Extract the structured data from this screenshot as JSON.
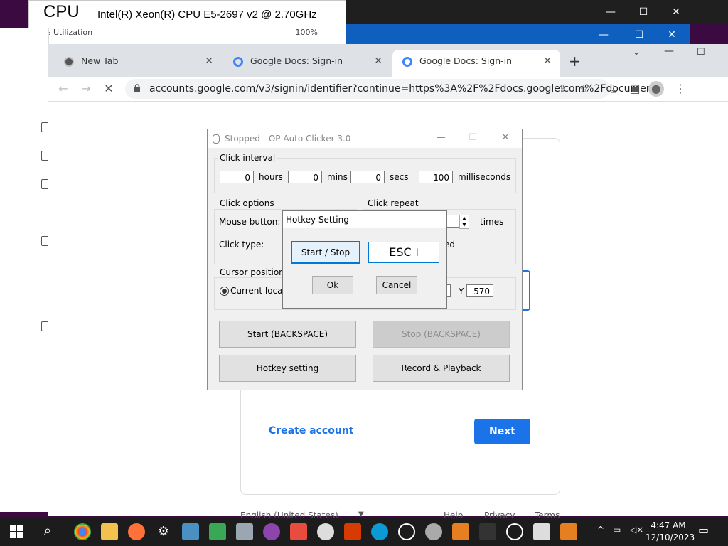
{
  "taskmgr": {
    "cpu": "CPU",
    "model": "Intel(R) Xeon(R) CPU E5-2697 v2 @ 2.70GHz",
    "util": "% Utilization",
    "pct": "100%"
  },
  "chrome": {
    "tabs": [
      {
        "label": "New Tab",
        "favicon": "chrome-icon"
      },
      {
        "label": "Google Docs: Sign-in",
        "favicon": "google-icon"
      },
      {
        "label": "Google Docs: Sign-in",
        "favicon": "google-icon"
      }
    ],
    "url": "accounts.google.com/v3/signin/identifier?continue=https%3A%2F%2Fdocs.google.com%2Fdocumen...",
    "create_account": "Create account",
    "next": "Next",
    "footer": {
      "language": "English (United States)",
      "help": "Help",
      "privacy": "Privacy",
      "terms": "Terms"
    }
  },
  "autoclicker": {
    "title": "Stopped - OP Auto Clicker 3.0",
    "interval": {
      "label": "Click interval",
      "hours": "0",
      "hours_label": "hours",
      "mins": "0",
      "mins_label": "mins",
      "secs": "0",
      "secs_label": "secs",
      "ms": "100",
      "ms_label": "milliseconds"
    },
    "options": {
      "label": "Click options",
      "mouse_button": "Mouse button:",
      "click_type": "Click type:"
    },
    "repeat": {
      "label": "Click repeat",
      "times": "times",
      "partial": "ed"
    },
    "cursor": {
      "label": "Cursor position",
      "current": "Current location",
      "y_label": "Y",
      "y_value": "570"
    },
    "buttons": {
      "start": "Start (BACKSPACE)",
      "stop": "Stop (BACKSPACE)",
      "hotkey": "Hotkey setting",
      "record": "Record & Playback"
    }
  },
  "hotkey_dialog": {
    "title": "Hotkey Setting",
    "start_stop": "Start / Stop",
    "key": "ESC",
    "ok": "Ok",
    "cancel": "Cancel"
  },
  "taskbar": {
    "time": "4:47 AM",
    "date": "12/10/2023"
  },
  "colors": {
    "accent": "#1a73e8",
    "taskbar": "#1c1c1c",
    "dialog_bg": "#f0f0f0"
  }
}
